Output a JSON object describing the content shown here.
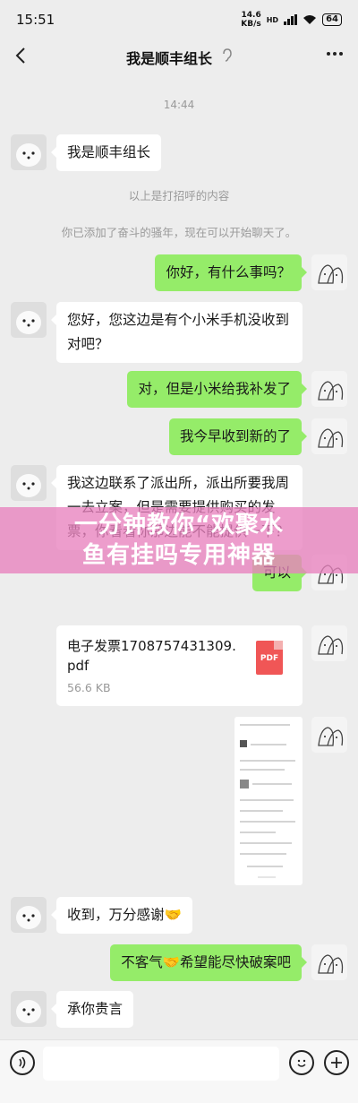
{
  "status": {
    "time": "15:51",
    "net_speed": "14.6",
    "net_unit": "KB/s",
    "signal": "HD",
    "battery": "64"
  },
  "header": {
    "title": "我是顺丰组长",
    "ear_icon": "ear-icon",
    "more_icon": "more-dots-icon"
  },
  "chat": {
    "timestamp": "14:44",
    "intro_message": "我是顺丰组长",
    "system_notes": [
      "以上是打招呼的内容",
      "你已添加了奋斗的骚年，现在可以开始聊天了。"
    ],
    "messages": [
      {
        "side": "right",
        "text": "你好，有什么事吗？"
      },
      {
        "side": "left",
        "text": "您好，您这边是有个小米手机没收到对吧？"
      },
      {
        "side": "right",
        "text": "对，但是小米给我补发了"
      },
      {
        "side": "right",
        "text": "我今早收到新的了"
      },
      {
        "side": "left",
        "text": "我这边联系了派出所，派出所要我周一去立案，但是需要提供购买的发票，你看看你那边能不能提供一下？"
      },
      {
        "side": "right",
        "text": "可以"
      },
      {
        "side": "left",
        "text": "收到，万分感谢🤝"
      },
      {
        "side": "right",
        "text": "不客气🤝希望能尽快破案吧"
      },
      {
        "side": "left",
        "text": "承你贵言"
      }
    ],
    "file": {
      "name": "电子发票1708757431309.pdf",
      "size": "56.6 KB",
      "type": "PDF"
    }
  },
  "overlay": {
    "line1": "一分钟教你“欢聚水",
    "line2": "鱼有挂吗专用神器"
  },
  "input": {
    "voice_icon": "voice-icon",
    "emoji_icon": "emoji-icon",
    "plus_icon": "plus-icon"
  }
}
